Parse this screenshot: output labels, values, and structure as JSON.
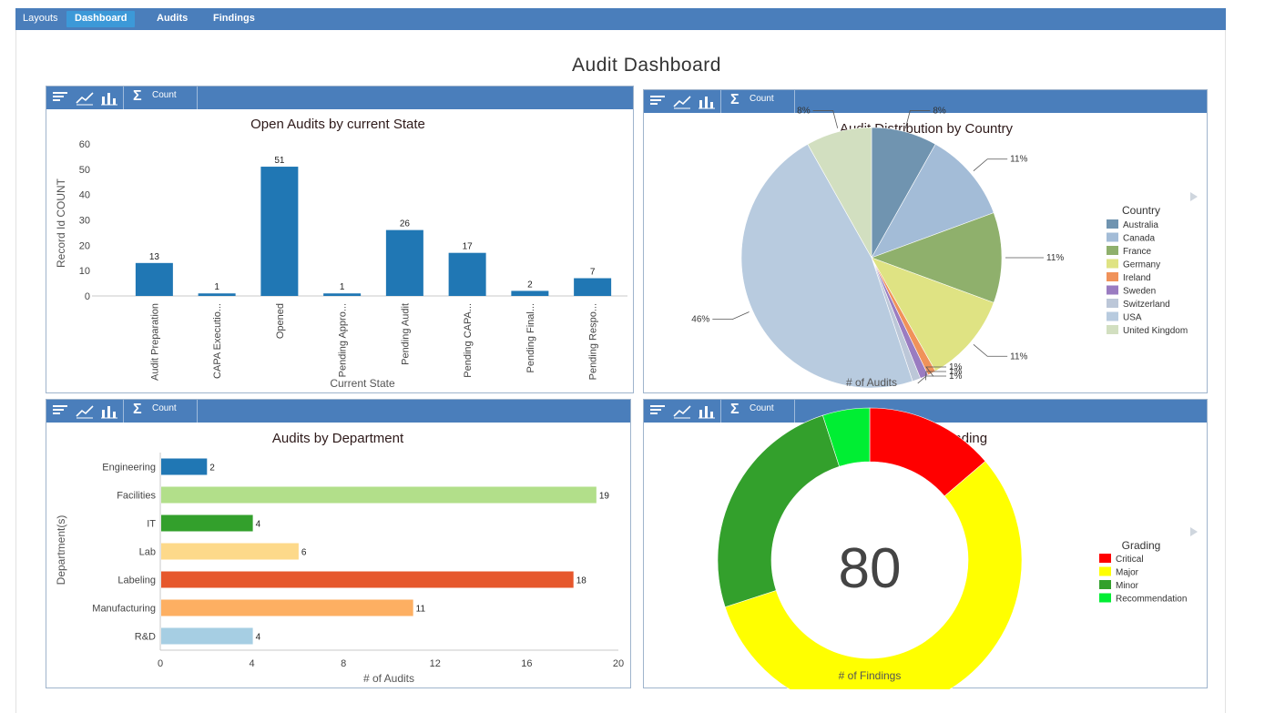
{
  "nav": {
    "layouts": "Layouts",
    "items": [
      {
        "label": "Dashboard",
        "active": true
      },
      {
        "label": "Audits",
        "active": false
      },
      {
        "label": "Findings",
        "active": false
      }
    ]
  },
  "page_title": "Audit Dashboard",
  "toolbar": {
    "count_label": "Count"
  },
  "colors": {
    "nav": "#4a7ebb",
    "active_tab": "#3c99d8"
  },
  "chart_data": [
    {
      "type": "bar",
      "title": "Open Audits by current State",
      "xlabel": "Current State",
      "ylabel": "Record Id COUNT",
      "ylim": [
        0,
        60
      ],
      "yticks": [
        "0",
        "10",
        "20",
        "30",
        "40",
        "50",
        "60"
      ],
      "categories": [
        "Audit Preparation",
        "CAPA Executio...",
        "Opened",
        "Pending Appro...",
        "Pending Audit",
        "Pending CAPA...",
        "Pending Final...",
        "Pending Respo..."
      ],
      "values": [
        13,
        1,
        51,
        1,
        26,
        17,
        2,
        7
      ],
      "color": "#2077b4"
    },
    {
      "type": "pie",
      "title": "Audit Distribution by Country",
      "xlabel": "# of Audits",
      "legend_title": "Country",
      "legend_position": "right",
      "slices": [
        {
          "label": "Australia",
          "pct_label": "8%",
          "value": 8,
          "color": "#7094b0"
        },
        {
          "label": "Canada",
          "pct_label": "11%",
          "value": 11,
          "color": "#a3bcd7"
        },
        {
          "label": "France",
          "pct_label": "11%",
          "value": 11,
          "color": "#8fb06c"
        },
        {
          "label": "Germany",
          "pct_label": "11%",
          "value": 11,
          "color": "#dfe383"
        },
        {
          "label": "Ireland",
          "pct_label": "1%",
          "value": 1,
          "color": "#f0925a"
        },
        {
          "label": "Sweden",
          "pct_label": "1%",
          "value": 1,
          "color": "#9a7cc1"
        },
        {
          "label": "Switzerland",
          "pct_label": "1%",
          "value": 1,
          "color": "#bcc7d8"
        },
        {
          "label": "USA",
          "pct_label": "46%",
          "value": 46,
          "color": "#b8cbdf"
        },
        {
          "label": "United Kingdom",
          "pct_label": "8%",
          "value": 8,
          "color": "#d2dfc0"
        }
      ]
    },
    {
      "type": "bar",
      "orientation": "horizontal",
      "title": "Audits by Department",
      "xlabel": "# of Audits",
      "ylabel": "Department(s)",
      "xlim": [
        0,
        20
      ],
      "xticks": [
        "0",
        "4",
        "8",
        "12",
        "16",
        "20"
      ],
      "categories": [
        "Engineering",
        "Facilities",
        "IT",
        "Lab",
        "Labeling",
        "Manufacturing",
        "R&D"
      ],
      "values": [
        2,
        19,
        4,
        6,
        18,
        11,
        4
      ],
      "colors": [
        "#2077b4",
        "#b2df8a",
        "#33a02c",
        "#fdd98a",
        "#e6572c",
        "#fdaf62",
        "#a6cee3"
      ]
    },
    {
      "type": "pie",
      "subtype": "donut",
      "title": "Findings by Grading",
      "xlabel": "# of Findings",
      "center_label": "80",
      "legend_title": "Grading",
      "legend_position": "right",
      "slices": [
        {
          "label": "Critical",
          "value": 11,
          "color": "#ff0000"
        },
        {
          "label": "Major",
          "value": 45,
          "color": "#ffff00"
        },
        {
          "label": "Minor",
          "value": 20,
          "color": "#33a02c"
        },
        {
          "label": "Recommendation",
          "value": 4,
          "color": "#00ee33"
        }
      ]
    }
  ]
}
